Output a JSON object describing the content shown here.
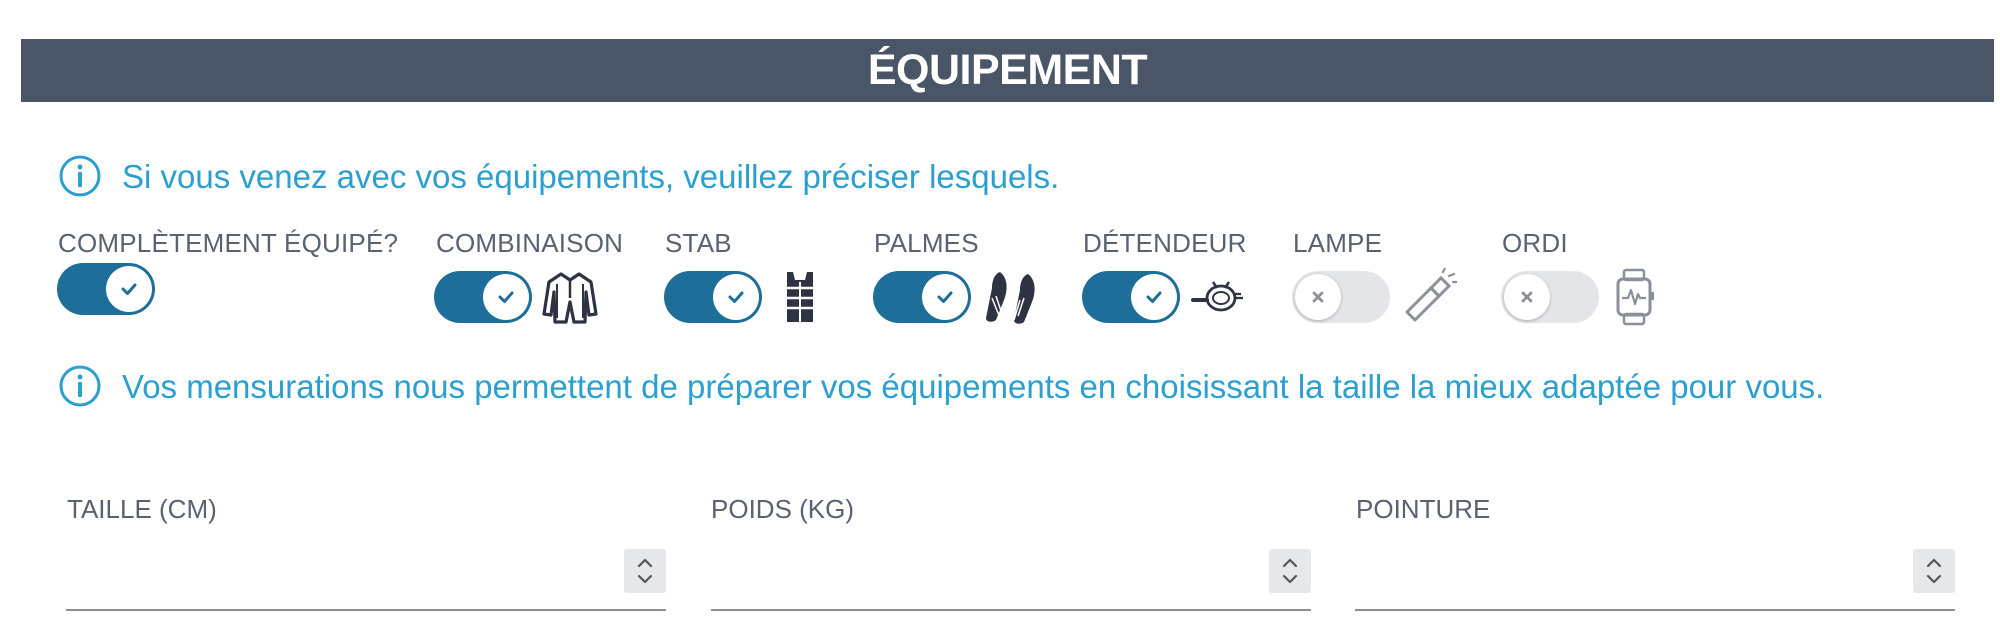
{
  "header": {
    "title": "ÉQUIPEMENT"
  },
  "info": {
    "equipment_note": "Si vous venez avec vos équipements, veuillez préciser lesquels.",
    "measurements_note": "Vos mensurations nous permettent de préparer vos équipements en choisissant la taille la mieux adaptée pour vous."
  },
  "equipment": [
    {
      "label": "COMPLÈTEMENT ÉQUIPÉ?",
      "checked": true,
      "icon": "none"
    },
    {
      "label": "COMBINAISON",
      "checked": true,
      "icon": "wetsuit-icon"
    },
    {
      "label": "STAB",
      "checked": true,
      "icon": "bcd-vest-icon"
    },
    {
      "label": "PALMES",
      "checked": true,
      "icon": "fins-icon"
    },
    {
      "label": "DÉTENDEUR",
      "checked": true,
      "icon": "regulator-icon"
    },
    {
      "label": "LAMPE",
      "checked": false,
      "icon": "flashlight-icon"
    },
    {
      "label": "ORDI",
      "checked": false,
      "icon": "dive-computer-icon"
    }
  ],
  "measurements": {
    "height": {
      "label": "TAILLE (CM)",
      "value": ""
    },
    "weight": {
      "label": "POIDS (KG)",
      "value": ""
    },
    "shoe_size": {
      "label": "POINTURE",
      "value": ""
    }
  },
  "colors": {
    "header_bg": "#4a5568",
    "accent": "#2a9fd0",
    "toggle_on": "#1d6f99",
    "toggle_off": "#e3e5e8"
  }
}
